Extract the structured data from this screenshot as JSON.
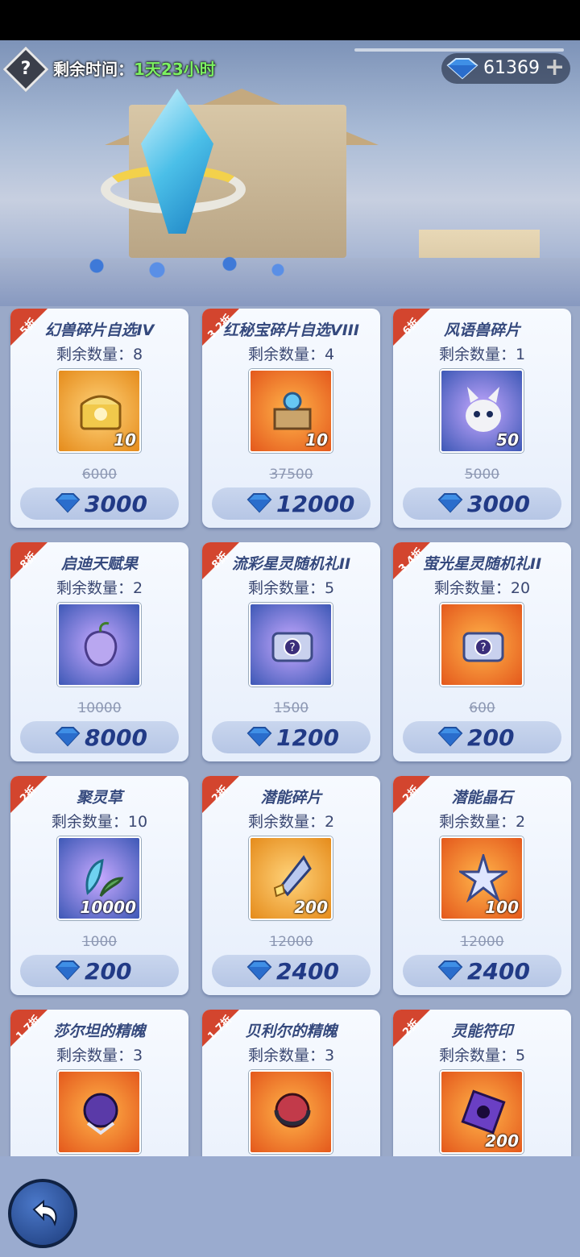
{
  "header": {
    "help_icon": "?",
    "timer_label": "剩余时间：",
    "timer_value": "1天23小时",
    "currency_amount": "61369",
    "currency_plus": "+"
  },
  "items": [
    {
      "discount": "5折",
      "name": "幻兽碎片自选IV",
      "stock": "剩余数量：8",
      "qty": "10",
      "old_price": "6000",
      "price": "3000",
      "icon": "treasure-chest-icon",
      "bg": "gold"
    },
    {
      "discount": "3.2折",
      "name": "红秘宝碎片自选VIII",
      "stock": "剩余数量：4",
      "qty": "10",
      "old_price": "37500",
      "price": "12000",
      "icon": "artifact-icon",
      "bg": "orange"
    },
    {
      "discount": "6折",
      "name": "风语兽碎片",
      "stock": "剩余数量：1",
      "qty": "50",
      "old_price": "5000",
      "price": "3000",
      "icon": "white-fox-icon",
      "bg": "blue"
    },
    {
      "discount": "8折",
      "name": "启迪天赋果",
      "stock": "剩余数量：2",
      "qty": "",
      "old_price": "10000",
      "price": "8000",
      "icon": "fruit-icon",
      "bg": "blue"
    },
    {
      "discount": "8折",
      "name": "流彩星灵随机礼II",
      "stock": "剩余数量：5",
      "qty": "",
      "old_price": "1500",
      "price": "1200",
      "icon": "mystery-box-icon",
      "bg": "blue"
    },
    {
      "discount": "3.4折",
      "name": "萤光星灵随机礼II",
      "stock": "剩余数量：20",
      "qty": "",
      "old_price": "600",
      "price": "200",
      "icon": "mystery-box-icon",
      "bg": "orange"
    },
    {
      "discount": "2折",
      "name": "聚灵草",
      "stock": "剩余数量：10",
      "qty": "10000",
      "old_price": "1000",
      "price": "200",
      "icon": "herb-icon",
      "bg": "blue"
    },
    {
      "discount": "2折",
      "name": "潜能碎片",
      "stock": "剩余数量：2",
      "qty": "200",
      "old_price": "12000",
      "price": "2400",
      "icon": "crystal-shard-icon",
      "bg": "gold"
    },
    {
      "discount": "2折",
      "name": "潜能晶石",
      "stock": "剩余数量：2",
      "qty": "100",
      "old_price": "12000",
      "price": "2400",
      "icon": "star-crystal-icon",
      "bg": "orange"
    },
    {
      "discount": "1.7折",
      "name": "莎尔坦的精魄",
      "stock": "剩余数量：3",
      "qty": "",
      "old_price": "",
      "price": "",
      "icon": "dark-orb-icon",
      "bg": "orange"
    },
    {
      "discount": "1.7折",
      "name": "贝利尔的精魄",
      "stock": "剩余数量：3",
      "qty": "",
      "old_price": "",
      "price": "",
      "icon": "red-orb-icon",
      "bg": "orange"
    },
    {
      "discount": "2折",
      "name": "灵能符印",
      "stock": "剩余数量：5",
      "qty": "200",
      "old_price": "",
      "price": "",
      "icon": "rune-icon",
      "bg": "orange"
    }
  ],
  "colors": {
    "accent_price": "#213a86",
    "badge": "#d3452e",
    "timer_green": "#7cf061"
  }
}
